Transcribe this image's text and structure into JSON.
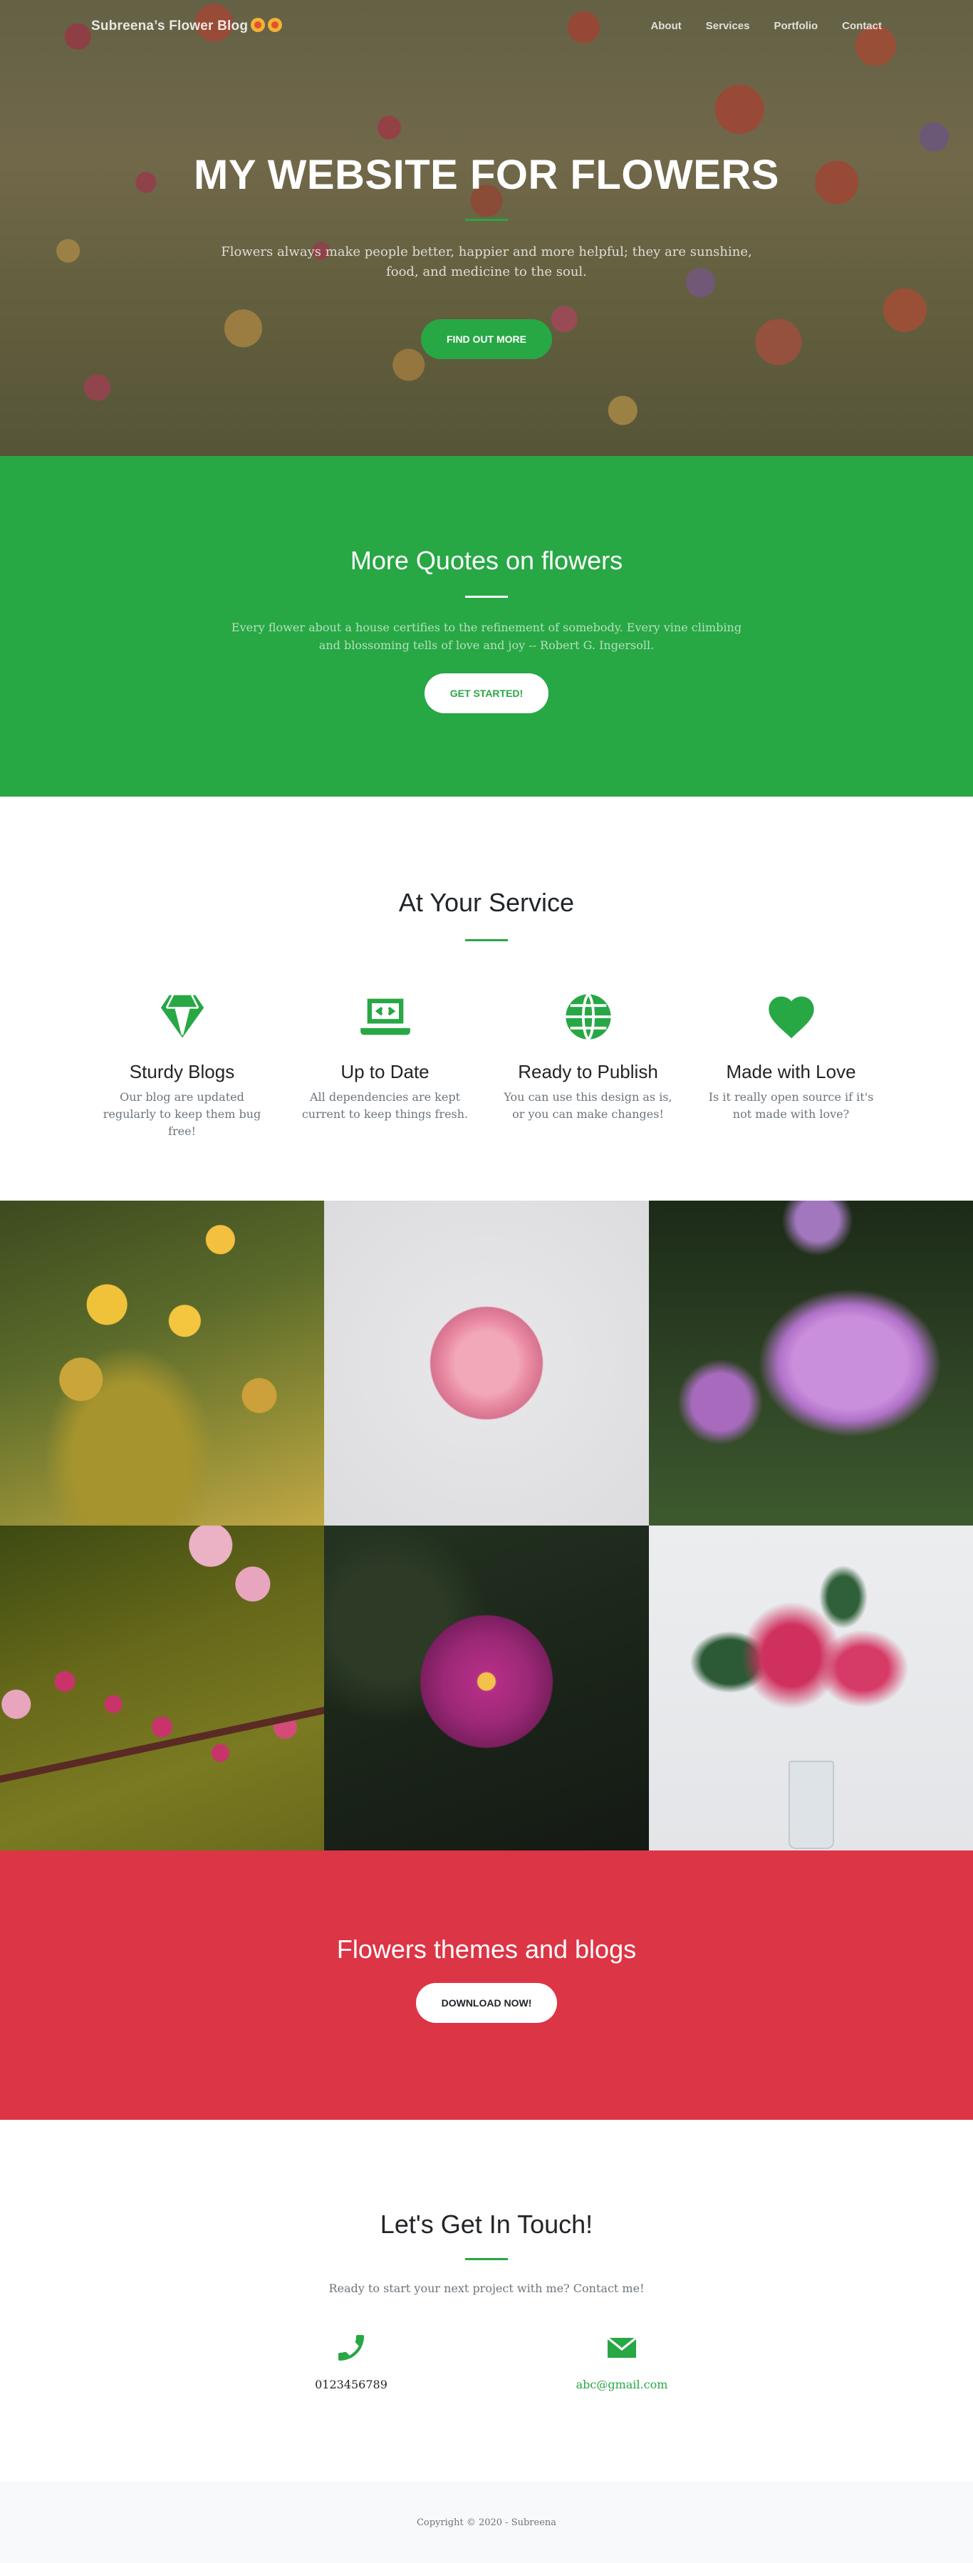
{
  "nav": {
    "brand": "Subreena’s Flower Blog",
    "links": [
      "About",
      "Services",
      "Portfolio",
      "Contact"
    ]
  },
  "hero": {
    "title": "MY WEBSITE FOR FLOWERS",
    "subtitle": "Flowers always make people better, happier and more helpful; they are sunshine, food, and medicine to the soul.",
    "button": "FIND OUT MORE"
  },
  "quotes": {
    "title": "More Quotes on flowers",
    "text": "Every flower about a house certifies to the refinement of somebody. Every vine climbing and blossoming tells of love and joy -- Robert G. Ingersoll.",
    "button": "GET STARTED!"
  },
  "services": {
    "title": "At Your Service",
    "items": [
      {
        "icon": "gem-icon",
        "title": "Sturdy Blogs",
        "text": "Our blog are updated regularly to keep them bug free!"
      },
      {
        "icon": "laptop-code-icon",
        "title": "Up to Date",
        "text": "All dependencies are kept current to keep things fresh."
      },
      {
        "icon": "globe-icon",
        "title": "Ready to Publish",
        "text": "You can use this design as is, or you can make changes!"
      },
      {
        "icon": "heart-icon",
        "title": "Made with Love",
        "text": "Is it really open source if it's not made with love?"
      }
    ]
  },
  "portfolio": {
    "tiles": [
      "yellow-wildflowers",
      "pink-rose",
      "purple-geranium",
      "cherry-blossom-bee",
      "magenta-zinnia",
      "pink-lily"
    ]
  },
  "cta": {
    "title": "Flowers themes and blogs",
    "button": "DOWNLOAD NOW!"
  },
  "contact": {
    "title": "Let's Get In Touch!",
    "lead": "Ready to start your next project with me? Contact me!",
    "phone": "0123456789",
    "email": "abc@gmail.com"
  },
  "footer": {
    "text": "Copyright © 2020 - Subreena"
  },
  "colors": {
    "primary": "#28a745",
    "danger": "#dc3545",
    "footer_bg": "#f8f9fa"
  }
}
